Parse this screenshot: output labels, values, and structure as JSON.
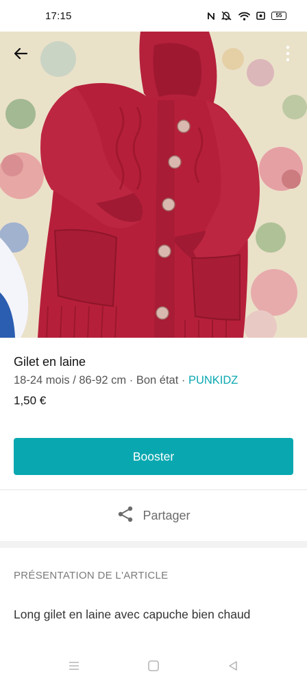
{
  "status_bar": {
    "time": "17:15",
    "battery": "55",
    "icons": [
      "nfc-icon",
      "mute-icon",
      "wifi-icon",
      "screen-record-icon",
      "battery-icon"
    ]
  },
  "photo": {
    "subject": "red knitted hooded cardigan on floral bedspread",
    "colors": {
      "garment": "#b81e3a",
      "bedspread": "#e9dfc6"
    }
  },
  "header": {
    "back_icon": "arrow-left-icon",
    "more_icon": "more-vertical-icon"
  },
  "item": {
    "title": "Gilet en laine",
    "size": "18-24 mois / 86-92 cm",
    "separator_1": " · ",
    "condition": "Bon état",
    "separator_2": " · ",
    "brand": "PUNKIDZ",
    "price": "1,50 €"
  },
  "actions": {
    "boost_label": "Booster",
    "share_label": "Partager",
    "share_icon": "share-icon"
  },
  "description_section": {
    "heading": "PRÉSENTATION DE L'ARTICLE",
    "text": "Long gilet en laine avec capuche bien chaud"
  },
  "nav_bar": {
    "icons": [
      "menu-icon",
      "home-icon",
      "back-triangle-icon"
    ]
  },
  "theme": {
    "accent": "#09a8b0",
    "brand_text": "#0aa7b0",
    "text_primary": "#111111",
    "text_secondary": "#555555"
  }
}
